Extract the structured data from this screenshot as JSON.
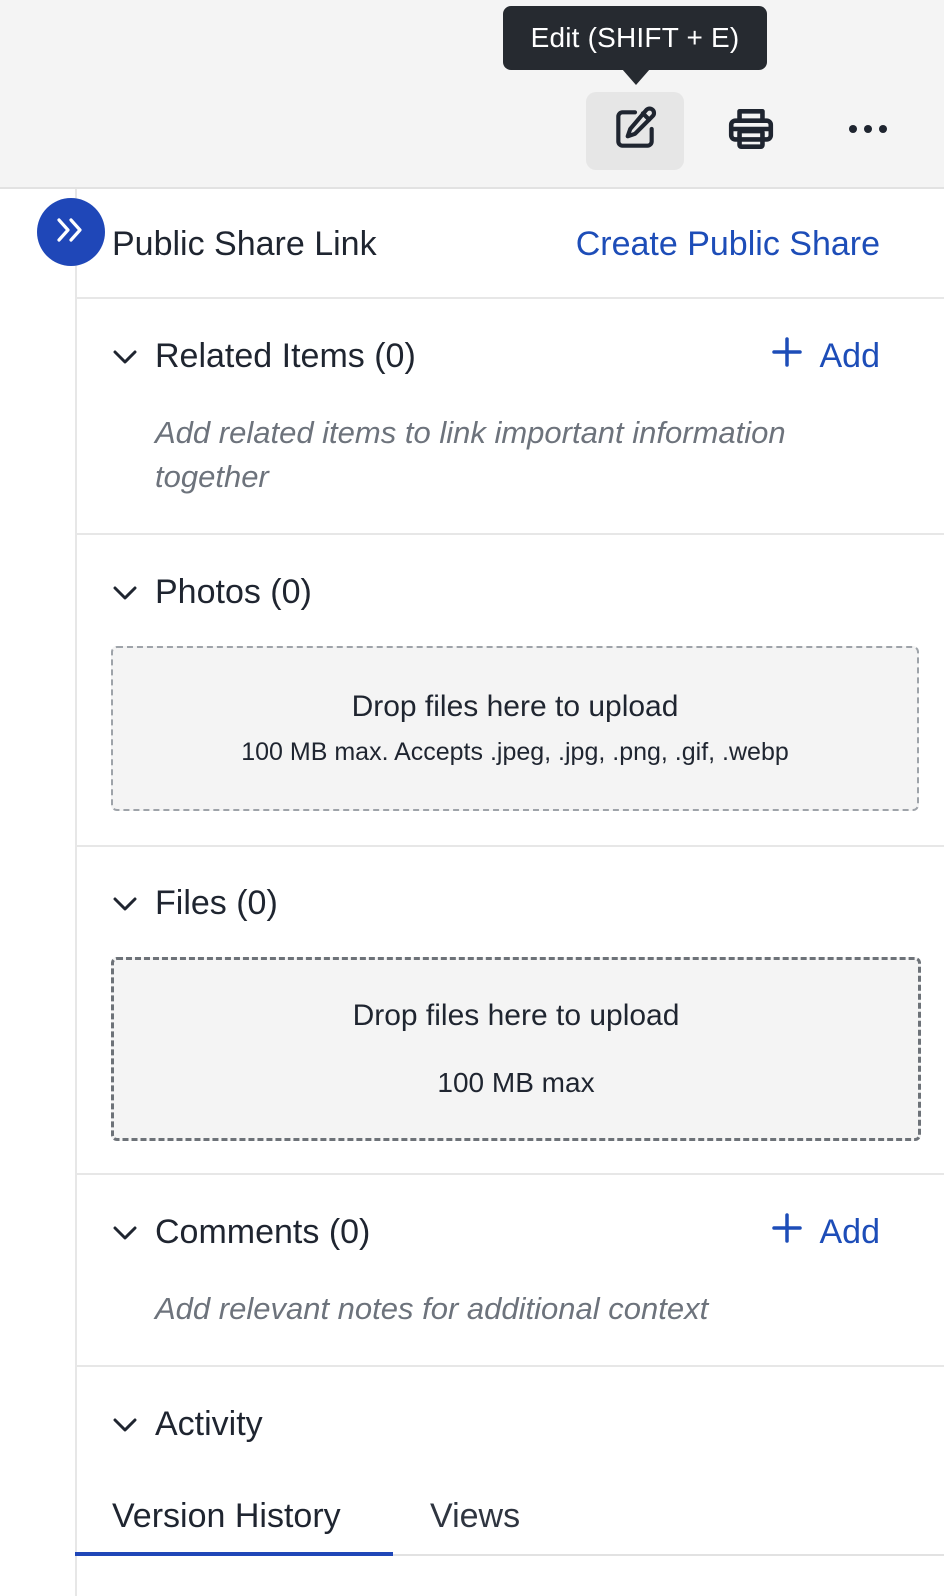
{
  "toolbar": {
    "tooltip": "Edit (SHIFT + E)",
    "edit_icon": "edit-icon",
    "print_icon": "printer-icon",
    "more_icon": "more-horizontal-icon"
  },
  "colors": {
    "accent": "#1f47b8",
    "link": "#1d4db8",
    "hint": "#6d737c"
  },
  "public_share": {
    "title": "Public Share Link",
    "action": "Create Public Share"
  },
  "sections": {
    "related": {
      "title": "Related Items (0)",
      "add_label": "Add",
      "hint_line1": "Add related items to link important information",
      "hint_line2": "together"
    },
    "photos": {
      "title": "Photos (0)",
      "drop_label": "Drop files here to upload",
      "drop_sub": "100 MB max. Accepts .jpeg, .jpg, .png, .gif, .webp"
    },
    "files": {
      "title": "Files (0)",
      "drop_label": "Drop files here to upload",
      "drop_sub": "100 MB max"
    },
    "comments": {
      "title": "Comments (0)",
      "add_label": "Add",
      "hint": "Add relevant notes for additional context"
    },
    "activity": {
      "title": "Activity",
      "tabs": [
        "Version History",
        "Views"
      ]
    }
  }
}
